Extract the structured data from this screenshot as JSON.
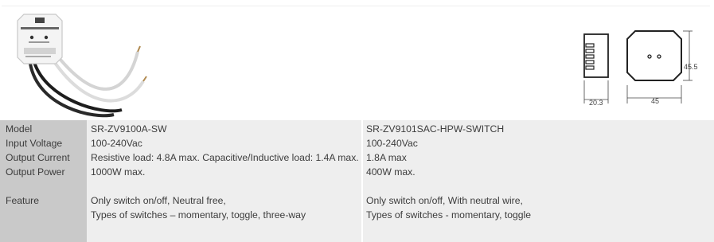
{
  "drawing": {
    "width_label": "20.3",
    "length_label": "45",
    "height_label": "45.5"
  },
  "specs": {
    "labels": {
      "model": "Model",
      "input_voltage": "Input Voltage",
      "output_current": "Output Current",
      "output_power": "Output Power",
      "feature": "Feature"
    },
    "product_a": {
      "model": "SR-ZV9100A-SW",
      "input_voltage": "100-240Vac",
      "output_current": "Resistive load: 4.8A max. Capacitive/Inductive load: 1.4A max.",
      "output_power": "1000W max.",
      "feature_line1": "Only switch on/off, Neutral free,",
      "feature_line2": "Types of switches – momentary, toggle, three-way"
    },
    "product_b": {
      "model": "SR-ZV9101SAC-HPW-SWITCH",
      "input_voltage": "100-240Vac",
      "output_current": "1.8A max",
      "output_power": "400W max.",
      "feature_line1": "Only switch on/off, With neutral wire,",
      "feature_line2": "Types of switches - momentary, toggle"
    }
  }
}
